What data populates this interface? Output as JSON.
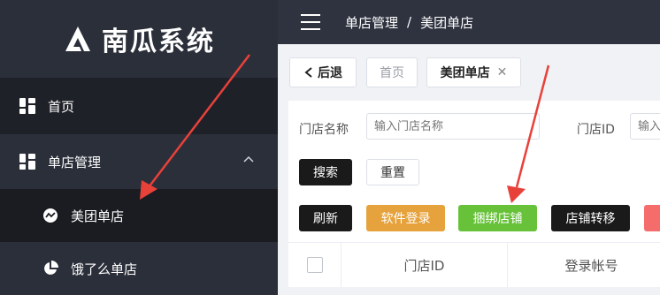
{
  "app": {
    "title": "南瓜系统"
  },
  "sidebar": {
    "items": [
      {
        "label": "首页",
        "icon": "grid-icon"
      },
      {
        "label": "单店管理",
        "icon": "grid-icon",
        "expanded": true
      },
      {
        "label": "美团单店",
        "icon": "meituan-icon",
        "active": true
      },
      {
        "label": "饿了么单店",
        "icon": "pie-icon"
      }
    ]
  },
  "header": {
    "breadcrumb": [
      "单店管理",
      "美团单店"
    ],
    "separator": "/"
  },
  "tabs": {
    "back": "后退",
    "home": "首页",
    "current": "美团单店",
    "close": "✕"
  },
  "filters": {
    "store_name_label": "门店名称",
    "store_name_placeholder": "输入门店名称",
    "store_id_label": "门店ID",
    "store_id_placeholder": "输入"
  },
  "actions": {
    "search": "搜索",
    "reset": "重置",
    "refresh": "刷新",
    "software_login": "软件登录",
    "bind_store": "捆绑店铺",
    "transfer_store": "店铺转移"
  },
  "table": {
    "columns": [
      "门店ID",
      "登录帐号"
    ]
  },
  "colors": {
    "sidebar_bg": "#2b2f3a",
    "active_bg": "#1b1c21",
    "annotation_arrow": "#e8413a",
    "orange": "#e6a23c",
    "green": "#67c23a"
  }
}
